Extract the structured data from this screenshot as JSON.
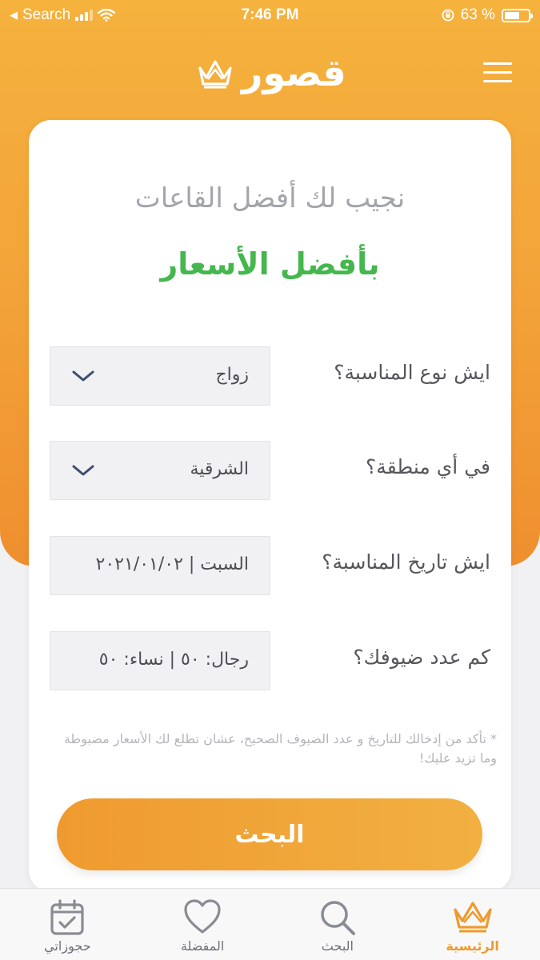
{
  "status_bar": {
    "back_app": "Search",
    "time": "7:46 PM",
    "battery": "63 %",
    "battery_level": 0.63
  },
  "header": {
    "logo_text": "قصور",
    "icons": {
      "logo": "crown-icon",
      "menu": "hamburger-menu-icon"
    }
  },
  "card": {
    "heading": "نجيب لك أفضل القاعات",
    "subheading": "بأفضل الأسعار",
    "fields": [
      {
        "label": "ايش نوع المناسبة؟",
        "value": "زواج",
        "icon": "chevron-down-icon"
      },
      {
        "label": "في أي منطقة؟",
        "value": "الشرقية",
        "icon": "chevron-down-icon"
      },
      {
        "label": "ايش تاريخ المناسبة؟",
        "value": "السبت | ٢٠٢١/٠١/٠٢"
      },
      {
        "label": "كم عدد ضيوفك؟",
        "value": "رجال: ٥٠ | نساء: ٥٠"
      }
    ],
    "note": "* تأكد من إدخالك للتاريخ و عدد الضيوف الصحيح، عشان تطلع لك الأسعار مضبوطة وما تزيد عليك!",
    "search_button": "البحث"
  },
  "tab_bar": {
    "tabs": [
      {
        "label": "الرئيسية",
        "icon": "crown-icon",
        "active": true
      },
      {
        "label": "البحث",
        "icon": "search-icon",
        "active": false
      },
      {
        "label": "المفضلة",
        "icon": "heart-icon",
        "active": false
      },
      {
        "label": "حجوزاتي",
        "icon": "calendar-check-icon",
        "active": false
      }
    ]
  },
  "colors": {
    "brand_orange": "#f3a53a",
    "accent_green": "#45b74e",
    "text_gray": "#a3a5ab"
  }
}
